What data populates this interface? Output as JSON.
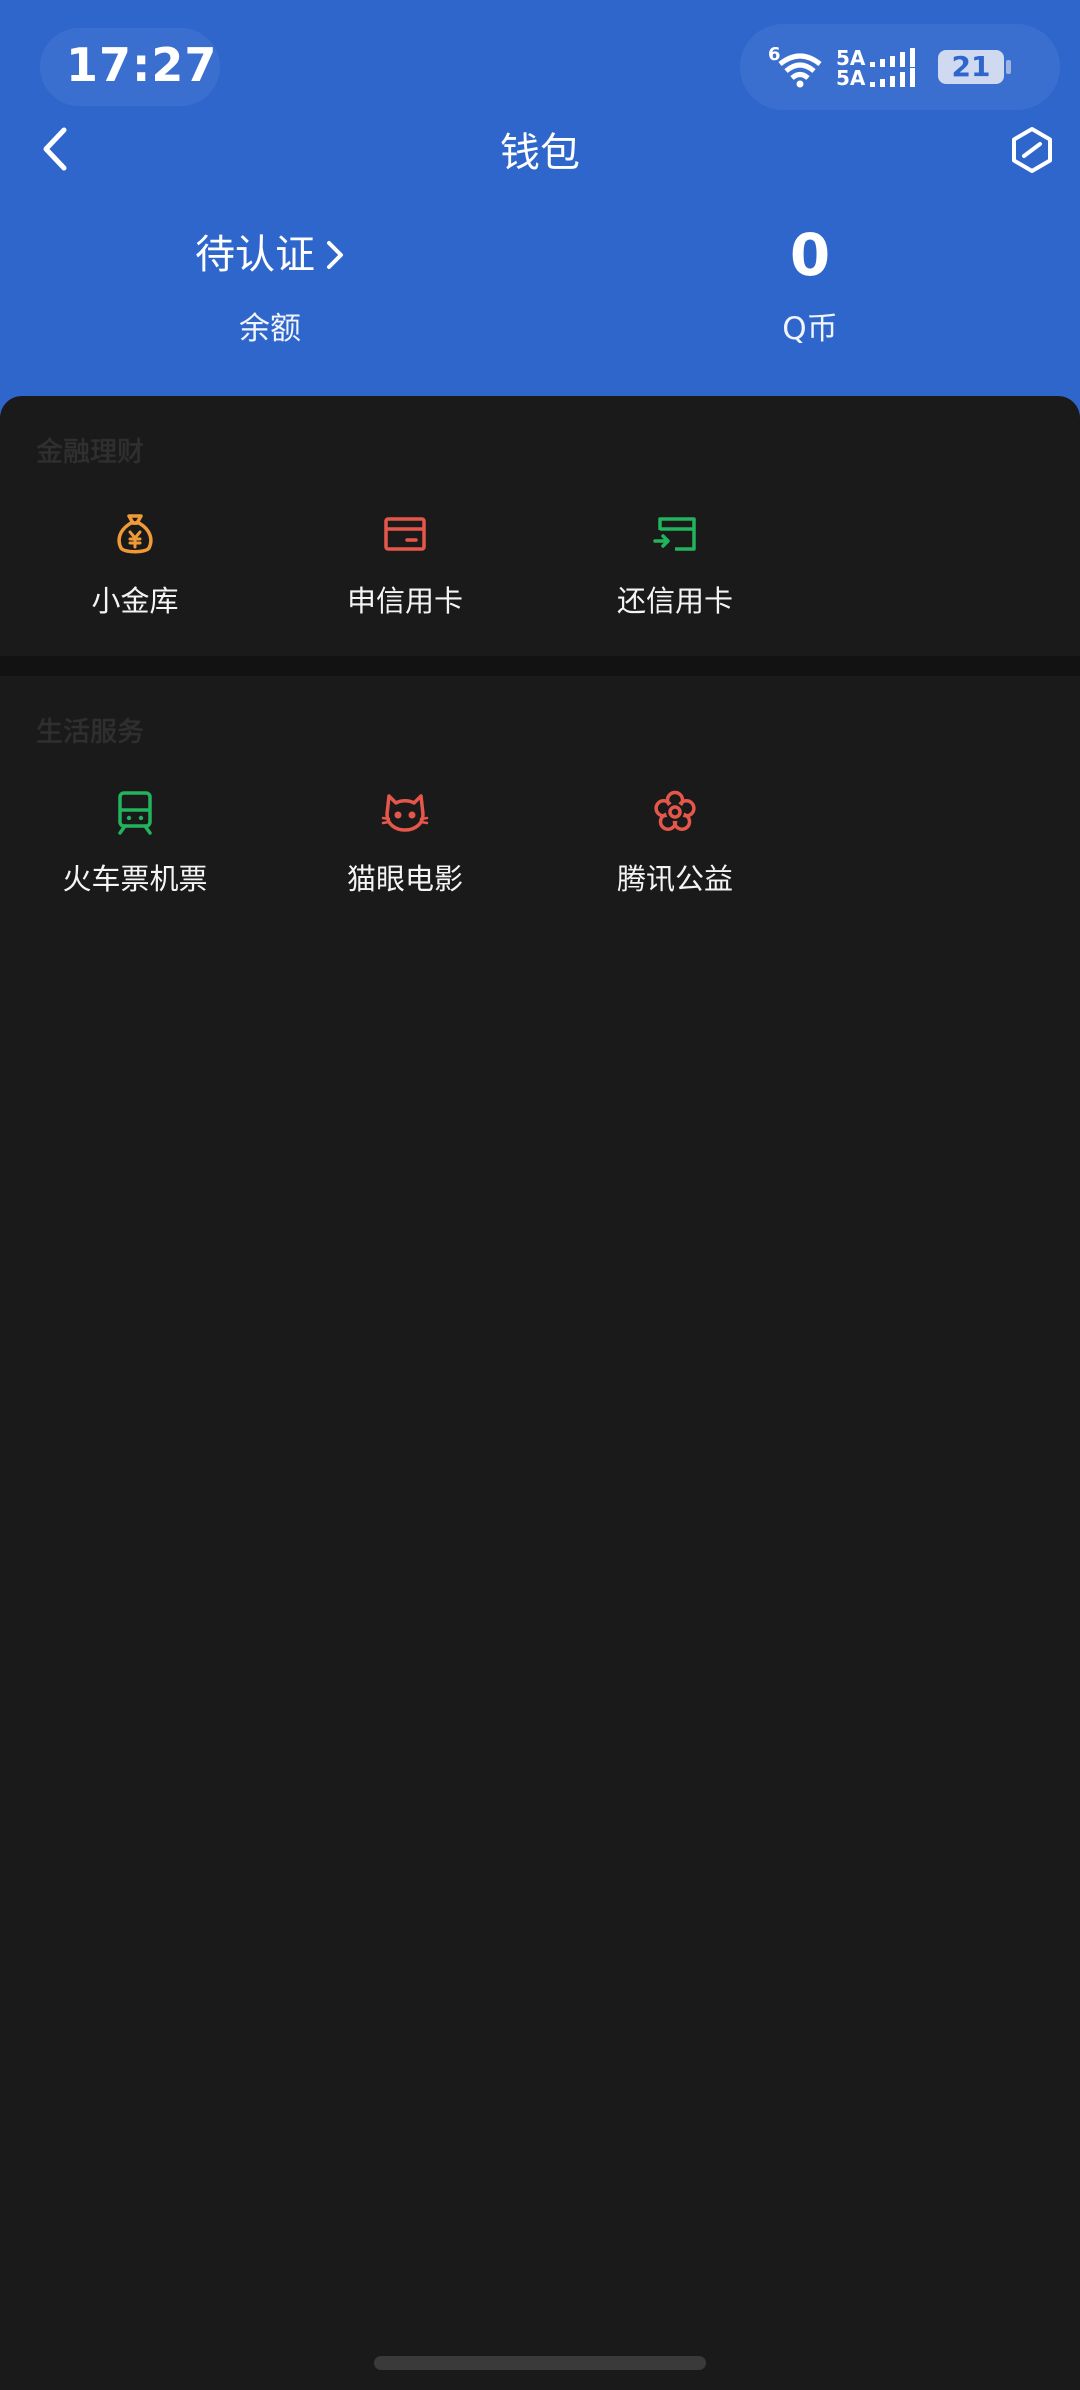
{
  "status_bar": {
    "time": "17:27",
    "network_top": "6",
    "sim1": "5A",
    "sim2": "5A",
    "battery": "21"
  },
  "nav": {
    "title": "钱包",
    "back_icon": "chevron-left-icon",
    "settings_icon": "hexagon-settings-icon"
  },
  "summary": {
    "balance_value": "待认证",
    "balance_label": "余额",
    "qcoin_value": "0",
    "qcoin_label": "Q币"
  },
  "sections": [
    {
      "title": "金融理财",
      "items": [
        {
          "label": "小金库",
          "icon": "money-bag-icon",
          "color": "#f09a37"
        },
        {
          "label": "申信用卡",
          "icon": "credit-card-icon",
          "color": "#e5574b"
        },
        {
          "label": "还信用卡",
          "icon": "card-repay-icon",
          "color": "#22b35e"
        }
      ]
    },
    {
      "title": "生活服务",
      "items": [
        {
          "label": "火车票机票",
          "icon": "train-icon",
          "color": "#22b35e"
        },
        {
          "label": "猫眼电影",
          "icon": "cat-face-icon",
          "color": "#e5574b"
        },
        {
          "label": "腾讯公益",
          "icon": "flower-icon",
          "color": "#e5574b"
        }
      ]
    }
  ],
  "colors": {
    "header_bg": "#2f66cc",
    "panel_bg": "#1a1a1a"
  }
}
